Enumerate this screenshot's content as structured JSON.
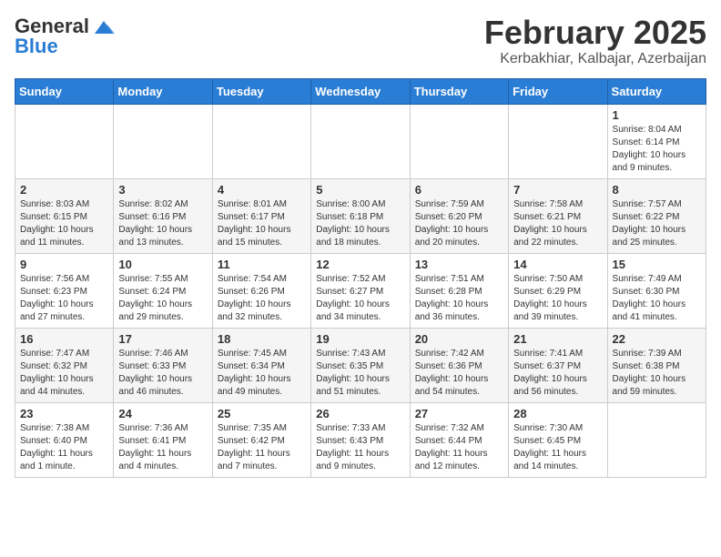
{
  "header": {
    "logo_line1": "General",
    "logo_line2": "Blue",
    "month": "February 2025",
    "location": "Kerbakhiar, Kalbajar, Azerbaijan"
  },
  "weekdays": [
    "Sunday",
    "Monday",
    "Tuesday",
    "Wednesday",
    "Thursday",
    "Friday",
    "Saturday"
  ],
  "weeks": [
    [
      {
        "day": "",
        "info": ""
      },
      {
        "day": "",
        "info": ""
      },
      {
        "day": "",
        "info": ""
      },
      {
        "day": "",
        "info": ""
      },
      {
        "day": "",
        "info": ""
      },
      {
        "day": "",
        "info": ""
      },
      {
        "day": "1",
        "info": "Sunrise: 8:04 AM\nSunset: 6:14 PM\nDaylight: 10 hours and 9 minutes."
      }
    ],
    [
      {
        "day": "2",
        "info": "Sunrise: 8:03 AM\nSunset: 6:15 PM\nDaylight: 10 hours and 11 minutes."
      },
      {
        "day": "3",
        "info": "Sunrise: 8:02 AM\nSunset: 6:16 PM\nDaylight: 10 hours and 13 minutes."
      },
      {
        "day": "4",
        "info": "Sunrise: 8:01 AM\nSunset: 6:17 PM\nDaylight: 10 hours and 15 minutes."
      },
      {
        "day": "5",
        "info": "Sunrise: 8:00 AM\nSunset: 6:18 PM\nDaylight: 10 hours and 18 minutes."
      },
      {
        "day": "6",
        "info": "Sunrise: 7:59 AM\nSunset: 6:20 PM\nDaylight: 10 hours and 20 minutes."
      },
      {
        "day": "7",
        "info": "Sunrise: 7:58 AM\nSunset: 6:21 PM\nDaylight: 10 hours and 22 minutes."
      },
      {
        "day": "8",
        "info": "Sunrise: 7:57 AM\nSunset: 6:22 PM\nDaylight: 10 hours and 25 minutes."
      }
    ],
    [
      {
        "day": "9",
        "info": "Sunrise: 7:56 AM\nSunset: 6:23 PM\nDaylight: 10 hours and 27 minutes."
      },
      {
        "day": "10",
        "info": "Sunrise: 7:55 AM\nSunset: 6:24 PM\nDaylight: 10 hours and 29 minutes."
      },
      {
        "day": "11",
        "info": "Sunrise: 7:54 AM\nSunset: 6:26 PM\nDaylight: 10 hours and 32 minutes."
      },
      {
        "day": "12",
        "info": "Sunrise: 7:52 AM\nSunset: 6:27 PM\nDaylight: 10 hours and 34 minutes."
      },
      {
        "day": "13",
        "info": "Sunrise: 7:51 AM\nSunset: 6:28 PM\nDaylight: 10 hours and 36 minutes."
      },
      {
        "day": "14",
        "info": "Sunrise: 7:50 AM\nSunset: 6:29 PM\nDaylight: 10 hours and 39 minutes."
      },
      {
        "day": "15",
        "info": "Sunrise: 7:49 AM\nSunset: 6:30 PM\nDaylight: 10 hours and 41 minutes."
      }
    ],
    [
      {
        "day": "16",
        "info": "Sunrise: 7:47 AM\nSunset: 6:32 PM\nDaylight: 10 hours and 44 minutes."
      },
      {
        "day": "17",
        "info": "Sunrise: 7:46 AM\nSunset: 6:33 PM\nDaylight: 10 hours and 46 minutes."
      },
      {
        "day": "18",
        "info": "Sunrise: 7:45 AM\nSunset: 6:34 PM\nDaylight: 10 hours and 49 minutes."
      },
      {
        "day": "19",
        "info": "Sunrise: 7:43 AM\nSunset: 6:35 PM\nDaylight: 10 hours and 51 minutes."
      },
      {
        "day": "20",
        "info": "Sunrise: 7:42 AM\nSunset: 6:36 PM\nDaylight: 10 hours and 54 minutes."
      },
      {
        "day": "21",
        "info": "Sunrise: 7:41 AM\nSunset: 6:37 PM\nDaylight: 10 hours and 56 minutes."
      },
      {
        "day": "22",
        "info": "Sunrise: 7:39 AM\nSunset: 6:38 PM\nDaylight: 10 hours and 59 minutes."
      }
    ],
    [
      {
        "day": "23",
        "info": "Sunrise: 7:38 AM\nSunset: 6:40 PM\nDaylight: 11 hours and 1 minute."
      },
      {
        "day": "24",
        "info": "Sunrise: 7:36 AM\nSunset: 6:41 PM\nDaylight: 11 hours and 4 minutes."
      },
      {
        "day": "25",
        "info": "Sunrise: 7:35 AM\nSunset: 6:42 PM\nDaylight: 11 hours and 7 minutes."
      },
      {
        "day": "26",
        "info": "Sunrise: 7:33 AM\nSunset: 6:43 PM\nDaylight: 11 hours and 9 minutes."
      },
      {
        "day": "27",
        "info": "Sunrise: 7:32 AM\nSunset: 6:44 PM\nDaylight: 11 hours and 12 minutes."
      },
      {
        "day": "28",
        "info": "Sunrise: 7:30 AM\nSunset: 6:45 PM\nDaylight: 11 hours and 14 minutes."
      },
      {
        "day": "",
        "info": ""
      }
    ]
  ]
}
